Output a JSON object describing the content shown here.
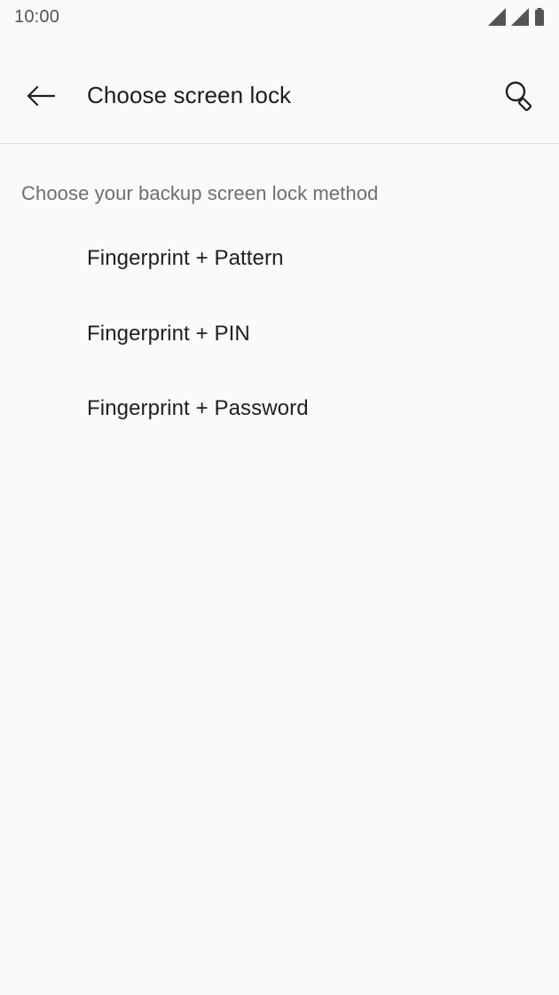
{
  "status_bar": {
    "time": "10:00",
    "icons": [
      "signal-icon",
      "signal-icon",
      "battery-icon"
    ]
  },
  "app_bar": {
    "back_icon": "arrow-left-icon",
    "title": "Choose screen lock",
    "search_icon": "search-icon"
  },
  "content": {
    "header": "Choose your backup screen lock method",
    "options": [
      {
        "label": "Fingerprint + Pattern"
      },
      {
        "label": "Fingerprint + PIN"
      },
      {
        "label": "Fingerprint + Password"
      }
    ]
  },
  "colors": {
    "background": "#fafafa",
    "divider": "#e0e0e0",
    "primary_text": "#1f1f1f",
    "secondary_text": "#6e6e6e"
  }
}
